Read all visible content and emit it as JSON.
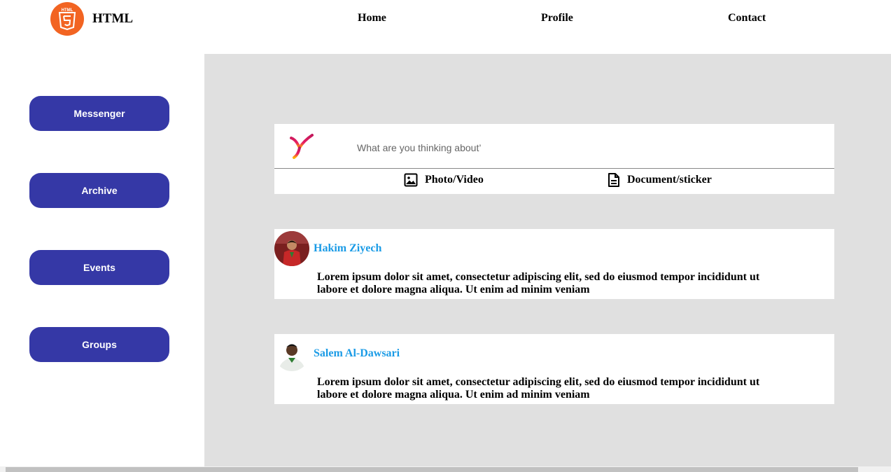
{
  "header": {
    "brand": "HTML",
    "logo_text": "HTML",
    "logo_color": "#f26422",
    "nav": [
      {
        "label": "Home"
      },
      {
        "label": "Profile"
      },
      {
        "label": "Contact"
      }
    ]
  },
  "sidebar": {
    "button_color": "#3538a6",
    "items": [
      {
        "label": "Messenger"
      },
      {
        "label": "Archive"
      },
      {
        "label": "Events"
      },
      {
        "label": "Groups"
      }
    ]
  },
  "composer": {
    "placeholder": "What are you thinking about’",
    "actions": [
      {
        "label": "Photo/Video",
        "icon": "image-icon"
      },
      {
        "label": "Document/sticker",
        "icon": "document-icon"
      }
    ]
  },
  "posts": [
    {
      "author": "Hakim Ziyech",
      "text": "Lorem ipsum dolor sit amet, consectetur adipiscing elit, sed do eiusmod tempor incididunt ut labore et dolore magna aliqua. Ut enim ad minim veniam"
    },
    {
      "author": "Salem Al-Dawsari",
      "text": "Lorem ipsum dolor sit amet, consectetur adipiscing elit, sed do eiusmod tempor incididunt ut labore et dolore magna aliqua. Ut enim ad minim veniam"
    }
  ],
  "colors": {
    "author_link": "#1a9be6",
    "main_background": "#e0e0e0"
  }
}
